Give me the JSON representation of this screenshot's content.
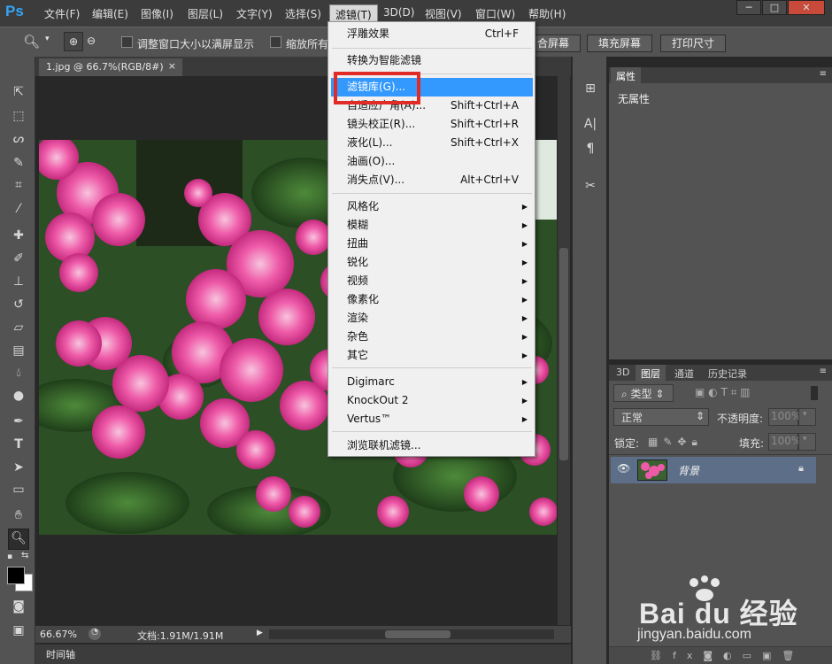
{
  "app": {
    "logo": "Ps"
  },
  "menubar": {
    "items": [
      "文件(F)",
      "编辑(E)",
      "图像(I)",
      "图层(L)",
      "文字(Y)",
      "选择(S)",
      "滤镜(T)",
      "3D(D)",
      "视图(V)",
      "窗口(W)",
      "帮助(H)"
    ],
    "active": "滤镜(T)"
  },
  "window_controls": {
    "minimize": "─",
    "maximize": "□",
    "close": "✕"
  },
  "options_bar": {
    "check1_label": "调整窗口大小以满屏显示",
    "check2_label": "缩放所有",
    "btn_fit": "合屏幕",
    "btn_fill": "填充屏幕",
    "btn_print": "打印尺寸"
  },
  "document": {
    "tab_title": "1.jpg @ 66.7%(RGB/8#)",
    "tab_close": "×"
  },
  "status": {
    "zoom": "66.67%",
    "doc_size": "文档:1.91M/1.91M"
  },
  "timeline": {
    "label": "时间轴"
  },
  "filter_menu": {
    "group1": [
      {
        "label": "浮雕效果",
        "shortcut": "Ctrl+F"
      }
    ],
    "group2": [
      {
        "label": "转换为智能滤镜"
      }
    ],
    "group3": [
      {
        "label": "滤镜库(G)...",
        "highlighted": true
      },
      {
        "label": "自适应广角(A)...",
        "shortcut": "Shift+Ctrl+A"
      },
      {
        "label": "镜头校正(R)...",
        "shortcut": "Shift+Ctrl+R"
      },
      {
        "label": "液化(L)...",
        "shortcut": "Shift+Ctrl+X"
      },
      {
        "label": "油画(O)..."
      },
      {
        "label": "消失点(V)...",
        "shortcut": "Alt+Ctrl+V"
      }
    ],
    "group4": [
      {
        "label": "风格化"
      },
      {
        "label": "模糊"
      },
      {
        "label": "扭曲"
      },
      {
        "label": "锐化"
      },
      {
        "label": "视频"
      },
      {
        "label": "像素化"
      },
      {
        "label": "渲染"
      },
      {
        "label": "杂色"
      },
      {
        "label": "其它"
      }
    ],
    "group5": [
      {
        "label": "Digimarc"
      },
      {
        "label": "KnockOut 2"
      },
      {
        "label": "Vertus™"
      }
    ],
    "group6": [
      {
        "label": "浏览联机滤镜..."
      }
    ]
  },
  "properties_panel": {
    "tab": "属性",
    "content": "无属性"
  },
  "layers_panel": {
    "tabs": [
      "3D",
      "图层",
      "通道",
      "历史记录"
    ],
    "active_tab": "图层",
    "filter_kind": "类型",
    "blend_mode": "正常",
    "opacity_label": "不透明度:",
    "opacity_value": "100%",
    "lock_label": "锁定:",
    "fill_label": "填充:",
    "fill_value": "100%",
    "layer_name": "背景"
  },
  "watermark": {
    "brand": "Bai du 经验",
    "url": "jingyan.baidu.com"
  },
  "colors": {
    "accent": "#3399ff",
    "highlight_box": "#e02b26",
    "ps_blue": "#33a5f7"
  }
}
